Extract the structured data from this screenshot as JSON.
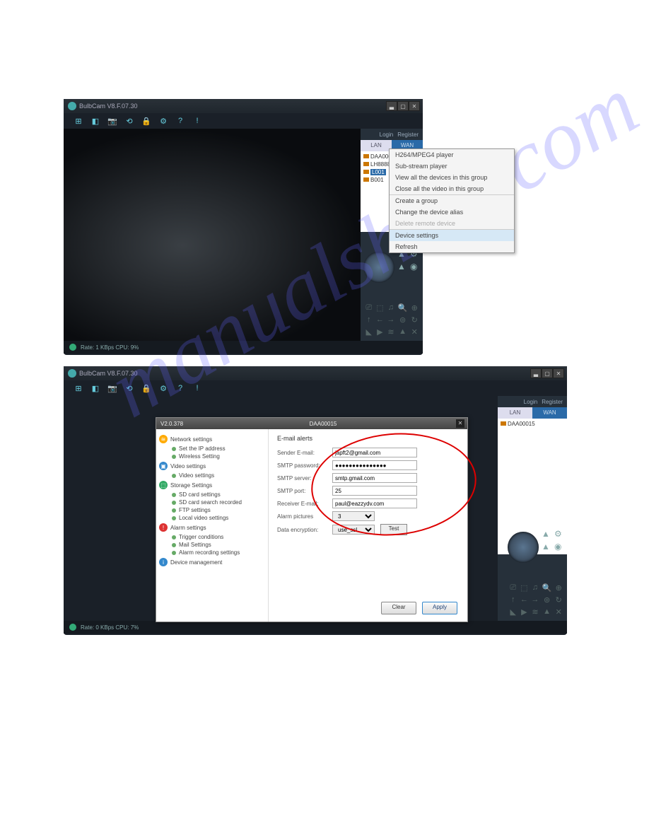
{
  "watermark": "manualshive.com",
  "app1": {
    "title": "BulbCam V8.F.07.30",
    "login": "Login",
    "register": "Register",
    "tabs": {
      "lan": "LAN",
      "wan": "WAN"
    },
    "devices": [
      "DAA00015",
      "LH888888",
      "L001",
      "B001"
    ],
    "ctx": {
      "items1": [
        "H264/MPEG4 player",
        "Sub-stream player",
        "View all the devices in this group",
        "Close all the video in this group"
      ],
      "items2": [
        "Create a group",
        "Change the device alias"
      ],
      "disabled": "Delete remote device",
      "hl": "Device settings",
      "last": "Refresh"
    },
    "status": "Rate: 1 KBps  CPU:  9%"
  },
  "app2": {
    "title": "BulbCam V8.F.07.30",
    "login": "Login",
    "register": "Register",
    "tabs": {
      "lan": "LAN",
      "wan": "WAN"
    },
    "devices": [
      "DAA00015"
    ],
    "status": "Rate: 0 KBps  CPU:  7%",
    "dlg": {
      "ver": "V2.0.378",
      "dev": "DAA00015",
      "tree": {
        "net": "Network settings",
        "net_c": [
          "Set the IP address",
          "Wireless Setting"
        ],
        "vid": "Video settings",
        "vid_c": [
          "Video settings"
        ],
        "sto": "Storage Settings",
        "sto_c": [
          "SD card settings",
          "SD card search recorded",
          "FTP settings",
          "Local video settings"
        ],
        "alm": "Alarm settings",
        "alm_c": [
          "Trigger conditions",
          "Mail Settings",
          "Alarm recording settings"
        ],
        "dm": "Device management"
      },
      "form": {
        "title": "E-mail alerts",
        "f": [
          {
            "l": "Sender E-mail:",
            "v": "japft2@gmail.com"
          },
          {
            "l": "SMTP password:",
            "v": "●●●●●●●●●●●●●●●"
          },
          {
            "l": "SMTP server:",
            "v": "smtp.gmail.com"
          },
          {
            "l": "SMTP port:",
            "v": "25"
          },
          {
            "l": "Receiver E-mail:",
            "v": "paul@eazzydv.com"
          }
        ],
        "alarm_l": "Alarm pictures",
        "alarm_v": "3",
        "enc_l": "Data encryption:",
        "enc_v": "use_ssl",
        "test": "Test",
        "clear": "Clear",
        "apply": "Apply"
      }
    }
  }
}
